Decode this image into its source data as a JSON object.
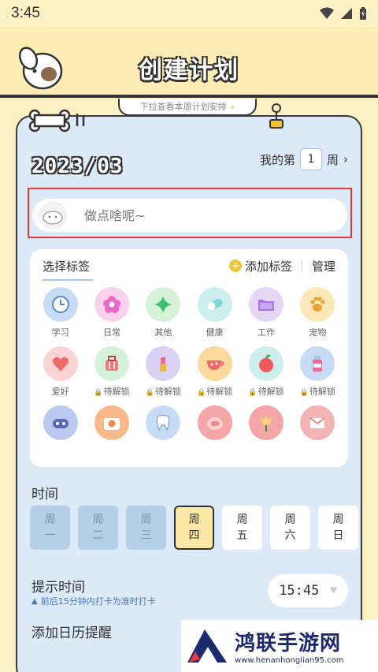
{
  "status": {
    "time": "3:45"
  },
  "header": {
    "title": "创建计划",
    "pulldown_hint": "下拉查看本周计划安排"
  },
  "date": {
    "display": "2023/03"
  },
  "week": {
    "prefix": "我的第",
    "number": "1",
    "suffix": "周"
  },
  "input": {
    "placeholder": "做点啥呢~"
  },
  "tags": {
    "title": "选择标签",
    "add_label": "添加标签",
    "manage_label": "管理",
    "items": [
      {
        "label": "学习",
        "icon": "clock-icon",
        "color": "#c7dcf4",
        "locked": false
      },
      {
        "label": "日常",
        "icon": "flower-icon",
        "color": "#f9d1ee",
        "locked": false
      },
      {
        "label": "其他",
        "icon": "star-icon",
        "color": "#d5f2d9",
        "locked": false
      },
      {
        "label": "健康",
        "icon": "pill-icon",
        "color": "#cdeeee",
        "locked": false
      },
      {
        "label": "工作",
        "icon": "folder-icon",
        "color": "#e4d6f4",
        "locked": false
      },
      {
        "label": "宠物",
        "icon": "paw-icon",
        "color": "#fbe8b4",
        "locked": false
      },
      {
        "label": "爱好",
        "icon": "heart-icon",
        "color": "#fbd3d3",
        "locked": false
      },
      {
        "label": "待解锁",
        "icon": "luggage-icon",
        "color": "#d5f2d9",
        "locked": true
      },
      {
        "label": "待解锁",
        "icon": "lipstick-icon",
        "color": "#d9d2f4",
        "locked": true
      },
      {
        "label": "待解锁",
        "icon": "teacup-icon",
        "color": "#fbd99c",
        "locked": true
      },
      {
        "label": "待解锁",
        "icon": "apple-icon",
        "color": "#cdeeee",
        "locked": true
      },
      {
        "label": "待解锁",
        "icon": "bottle-icon",
        "color": "#c7dcf4",
        "locked": true
      },
      {
        "label": "",
        "icon": "gamepad-icon",
        "color": "#b9c9ef",
        "locked": true
      },
      {
        "label": "",
        "icon": "camera-icon",
        "color": "#f7b98a",
        "locked": true
      },
      {
        "label": "",
        "icon": "tooth-icon",
        "color": "#c7dcf4",
        "locked": true
      },
      {
        "label": "",
        "icon": "piggy-icon",
        "color": "#f4a6a6",
        "locked": true
      },
      {
        "label": "",
        "icon": "tulip-icon",
        "color": "#f4a6a6",
        "locked": true
      },
      {
        "label": "",
        "icon": "envelope-icon",
        "color": "#f4b3b3",
        "locked": true
      }
    ]
  },
  "time_section": {
    "title": "时间",
    "days": [
      {
        "top": "周",
        "bottom": "一",
        "state": "past"
      },
      {
        "top": "周",
        "bottom": "二",
        "state": "past"
      },
      {
        "top": "周",
        "bottom": "三",
        "state": "past"
      },
      {
        "top": "周",
        "bottom": "四",
        "state": "today"
      },
      {
        "top": "周",
        "bottom": "五",
        "state": "future"
      },
      {
        "top": "周",
        "bottom": "六",
        "state": "future"
      },
      {
        "top": "周",
        "bottom": "日",
        "state": "future"
      }
    ]
  },
  "reminder": {
    "title": "提示时间",
    "subtitle": "前后15分钟内打卡为准时打卡",
    "time": "15:45"
  },
  "calendar": {
    "title": "添加日历提醒"
  },
  "watermark": {
    "text": "鸿联手游网",
    "url": "www.henanhonglian95.com"
  }
}
